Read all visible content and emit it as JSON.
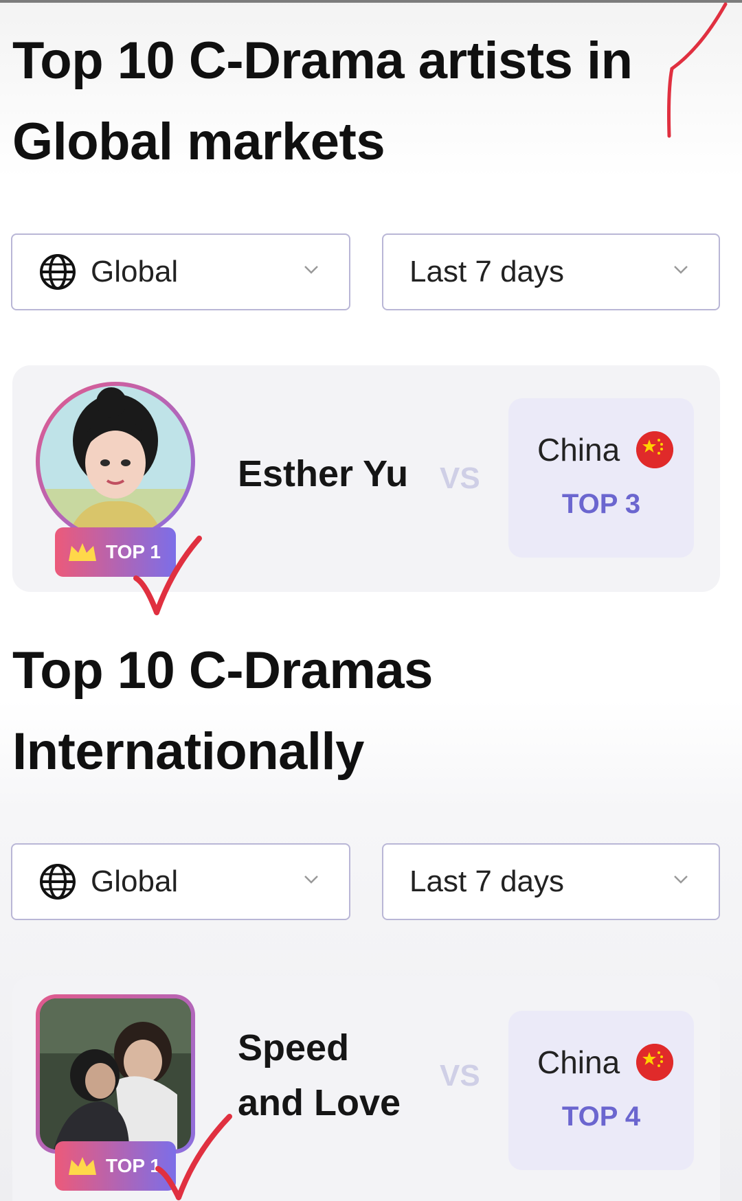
{
  "sections": [
    {
      "title": "Top 10 C-Drama artists in Global markets",
      "region_filter": "Global",
      "period_filter": "Last 7 days",
      "entry": {
        "badge": "TOP 1",
        "name": "Esther Yu",
        "vs": "VS",
        "country": "China",
        "country_rank": "TOP 3",
        "avatar": "avatar-photo"
      }
    },
    {
      "title": "Top 10 C-Dramas Internationally",
      "region_filter": "Global",
      "period_filter": "Last 7 days",
      "entry": {
        "badge": "TOP 1",
        "name": "Speed and Love",
        "vs": "VS",
        "country": "China",
        "country_rank": "TOP 4",
        "avatar": "drama-poster"
      }
    }
  ],
  "icons": {
    "globe": "globe-icon",
    "chevron": "chevron-down-icon",
    "crown": "crown-icon",
    "flag": "china-flag-icon"
  },
  "colors": {
    "accent": "#6b66cf",
    "badge_start": "#ec5a7a",
    "badge_end": "#7c6ee8",
    "annotation": "#e03040"
  }
}
